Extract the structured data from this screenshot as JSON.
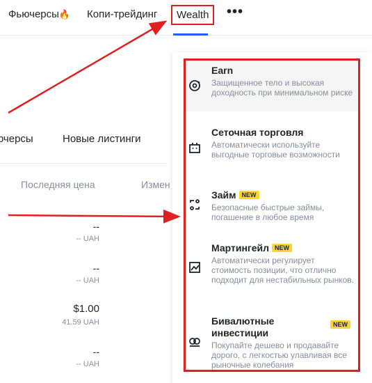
{
  "nav": {
    "futures": "Фьючерсы",
    "fire_icon": "🔥",
    "copy_trading": "Копи-трейдинг",
    "wealth": "Wealth",
    "more": "•••"
  },
  "market": {
    "tab_futures": "ючерсы",
    "tab_new_listings": "Новые листинги",
    "col_last_price": "Последняя цена",
    "col_change": "Измен",
    "rows": [
      {
        "price": "--",
        "sub": "-- UAH"
      },
      {
        "price": "--",
        "sub": "-- UAH"
      },
      {
        "price": "$1.00",
        "sub": "41.59 UAH"
      },
      {
        "price": "--",
        "sub": "-- UAH"
      }
    ]
  },
  "dropdown": {
    "items": [
      {
        "title": "Earn",
        "desc": "Защищенное тело и высокая доходность при минимальном риске",
        "icon": "earn-icon",
        "badge": ""
      },
      {
        "title": "Сеточная торговля",
        "desc": "Автоматически используйте выгодные торговые возможности",
        "icon": "grid-bot-icon",
        "badge": ""
      },
      {
        "title": "Займ",
        "desc": "Безопасные быстрые займы, погашение в любое время",
        "icon": "loan-icon",
        "badge": "NEW"
      },
      {
        "title": "Мартингейл",
        "desc": "Автоматически регулирует стоимость позиции, что отлично подходит для нестабильных рынков.",
        "icon": "martingale-icon",
        "badge": "NEW"
      },
      {
        "title": "Бивалютные инвестиции",
        "desc": "Покупайте дешево и продавайте дорого, с легкостью улавливая все рыночные колебания",
        "icon": "dual-currency-icon",
        "badge": "NEW"
      }
    ]
  },
  "colors": {
    "annotation_red": "#e02020",
    "accent_blue": "#1e5eff",
    "badge_yellow": "#fcd535"
  }
}
